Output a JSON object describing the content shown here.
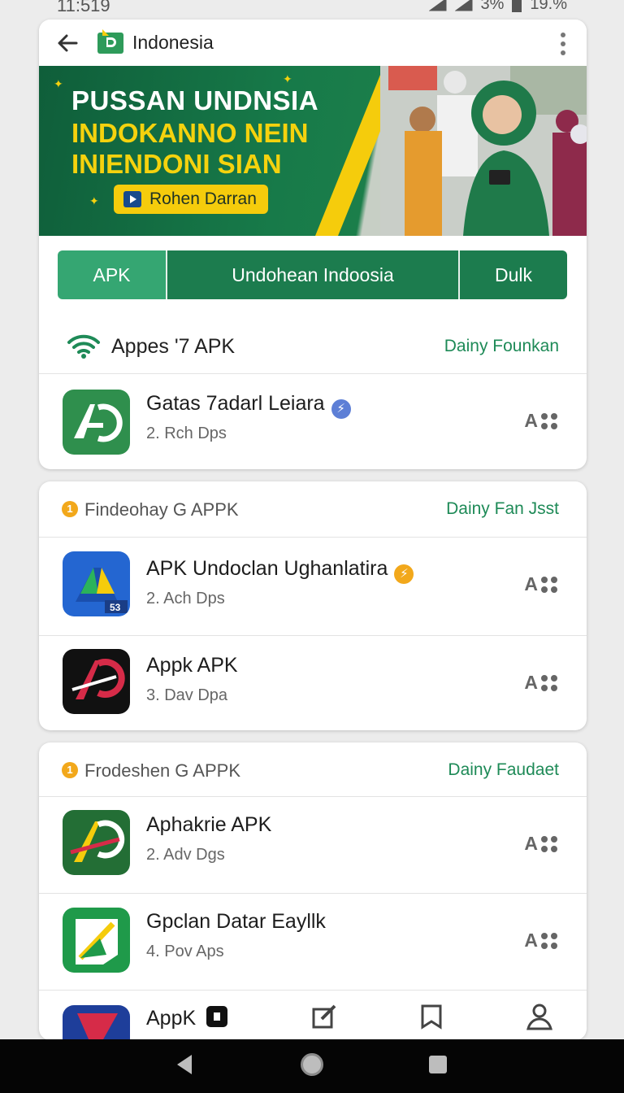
{
  "status_bar": {
    "time": "11:519",
    "battery": "3%",
    "right_text": "19.%"
  },
  "header": {
    "title": "Indonesia"
  },
  "banner": {
    "line1": "PUSSAN UNDNSIA",
    "line2": "INDOKANNO NEIN",
    "line3": "INIENDONI SIAN",
    "cta_label": "Rohen Darran"
  },
  "tabs": [
    {
      "label": "APK",
      "active": true
    },
    {
      "label": "Undohean Indoosia",
      "active": false
    },
    {
      "label": "Dulk",
      "active": false
    }
  ],
  "section1": {
    "title": "Appes '7 APK",
    "more": "Dainy Founkan",
    "apps": [
      {
        "name": "Gatas 7adarl Leiara",
        "sub": "2. Rch Dps",
        "action": "A",
        "icon": "ad-green-icon",
        "badge": "verified-blue"
      }
    ]
  },
  "section2": {
    "title": "Findeohay G APPK",
    "more": "Dainy Fan Jsst",
    "apps": [
      {
        "name": "APK Undoclan Ughanlatira",
        "sub": "2. Ach Dps",
        "action": "A",
        "icon": "drive-blue-icon",
        "icon_text": "53",
        "badge": "verified-orange"
      },
      {
        "name": "Appk APK",
        "sub": "3. Dav Dpa",
        "action": "A",
        "icon": "ap-black-icon"
      }
    ]
  },
  "section3": {
    "title": "Frodeshen G APPK",
    "more": "Dainy Faudaet",
    "apps": [
      {
        "name": "Aphakrie APK",
        "sub": "2. Adv Dgs",
        "action": "A",
        "icon": "ap-green-icon"
      },
      {
        "name": "Gpclan Datar Eayllk",
        "sub": "4. Pov Aps",
        "action": "A",
        "icon": "paper-green-icon"
      }
    ],
    "partial_app": {
      "name": "AppK"
    }
  },
  "colors": {
    "primary": "#1c7c4e",
    "tab_active": "#35a672",
    "accent": "#f5cc0c",
    "link": "#1e8a57"
  }
}
